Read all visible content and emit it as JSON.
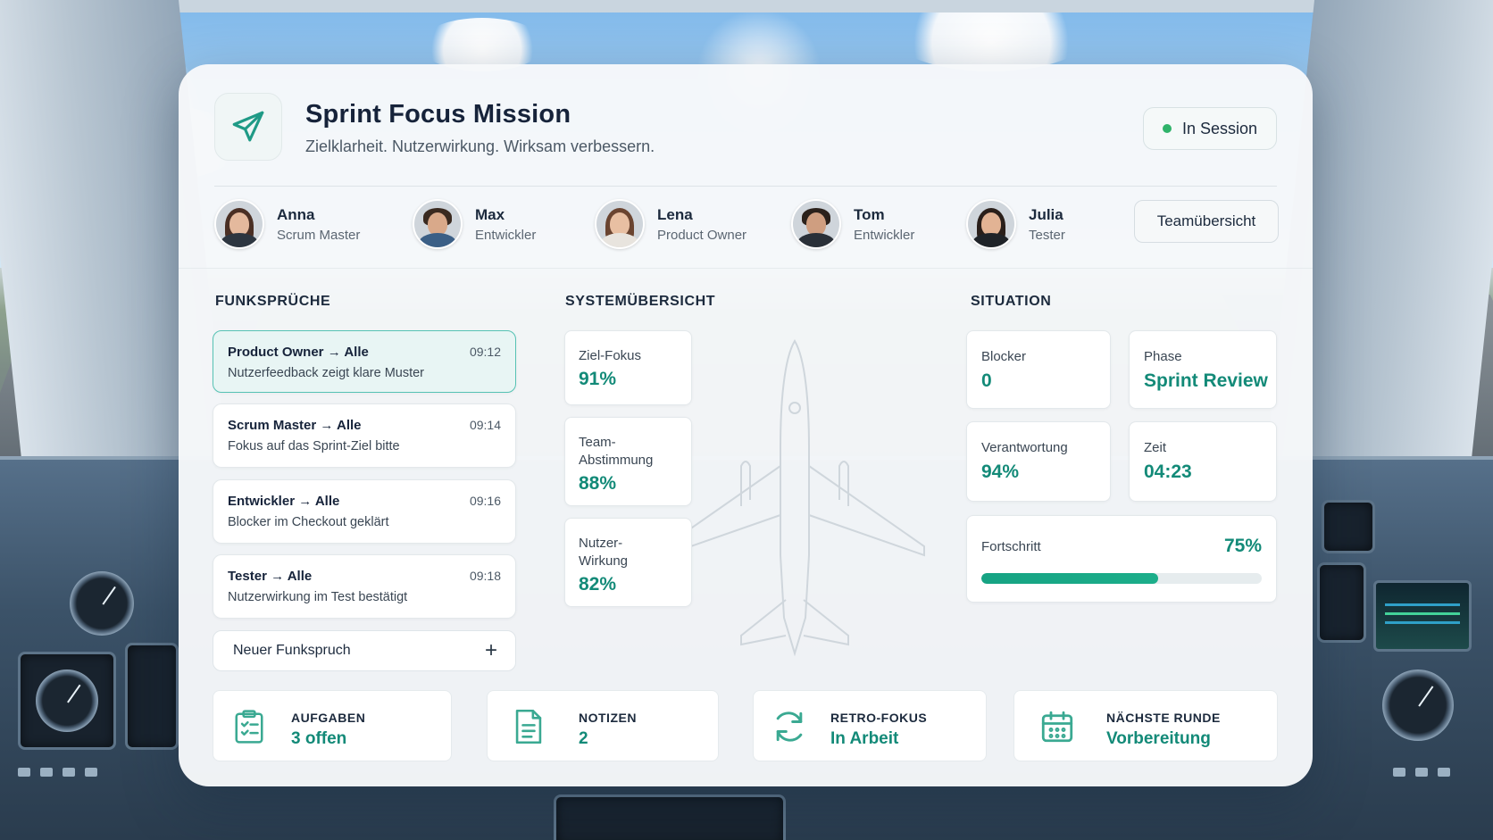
{
  "header": {
    "title": "Sprint Focus Mission",
    "subtitle": "Zielklarheit. Nutzerwirkung. Wirksam verbessern.",
    "status": "In Session",
    "logo_icon": "paper-plane-icon"
  },
  "team": {
    "members": [
      {
        "name": "Anna",
        "role": "Scrum Master"
      },
      {
        "name": "Max",
        "role": "Entwickler"
      },
      {
        "name": "Lena",
        "role": "Product Owner"
      },
      {
        "name": "Tom",
        "role": "Entwickler"
      },
      {
        "name": "Julia",
        "role": "Tester"
      }
    ],
    "overview_button": "Teamübersicht"
  },
  "funksprueche": {
    "title": "FUNKSPRÜCHE",
    "messages": [
      {
        "from": "Product Owner",
        "to": "Alle",
        "time": "09:12",
        "text": "Nutzerfeedback zeigt klare Muster"
      },
      {
        "from": "Scrum Master",
        "to": "Alle",
        "time": "09:14",
        "text": "Fokus auf das Sprint-Ziel bitte"
      },
      {
        "from": "Entwickler",
        "to": "Alle",
        "time": "09:16",
        "text": "Blocker im Checkout geklärt"
      },
      {
        "from": "Tester",
        "to": "Alle",
        "time": "09:18",
        "text": "Nutzerwirkung im Test bestätigt"
      }
    ],
    "arrow": "→",
    "new_message": "Neuer Funkspruch",
    "plus": "+"
  },
  "systemuebersicht": {
    "title": "SYSTEMÜBERSICHT",
    "cards": [
      {
        "label": "Ziel-Fokus",
        "value": "91%"
      },
      {
        "label": "Team-\nAbstimmung",
        "value": "88%"
      },
      {
        "label": "Nutzer-\nWirkung",
        "value": "82%"
      }
    ]
  },
  "situation": {
    "title": "SITUATION",
    "blocker": {
      "label": "Blocker",
      "value": "0"
    },
    "phase": {
      "label": "Phase",
      "value": "Sprint Review"
    },
    "verantwortung": {
      "label": "Verantwortung",
      "value": "94%"
    },
    "zeit": {
      "label": "Zeit",
      "value": "04:23"
    },
    "fortschritt": {
      "label": "Fortschritt",
      "value": "75%",
      "fraction": 0.63
    }
  },
  "bottom": {
    "tiles": [
      {
        "label": "AUFGABEN",
        "value": "3 offen",
        "icon": "clipboard-icon"
      },
      {
        "label": "NOTIZEN",
        "value": "2",
        "icon": "document-icon"
      },
      {
        "label": "RETRO-FOKUS",
        "value": "In Arbeit",
        "icon": "refresh-icon"
      },
      {
        "label": "NÄCHSTE RUNDE",
        "value": "Vorbereitung",
        "icon": "calendar-icon"
      }
    ]
  },
  "colors": {
    "accent": "#138a78",
    "status": "#2fb36a",
    "active_border": "#56c2b4"
  }
}
